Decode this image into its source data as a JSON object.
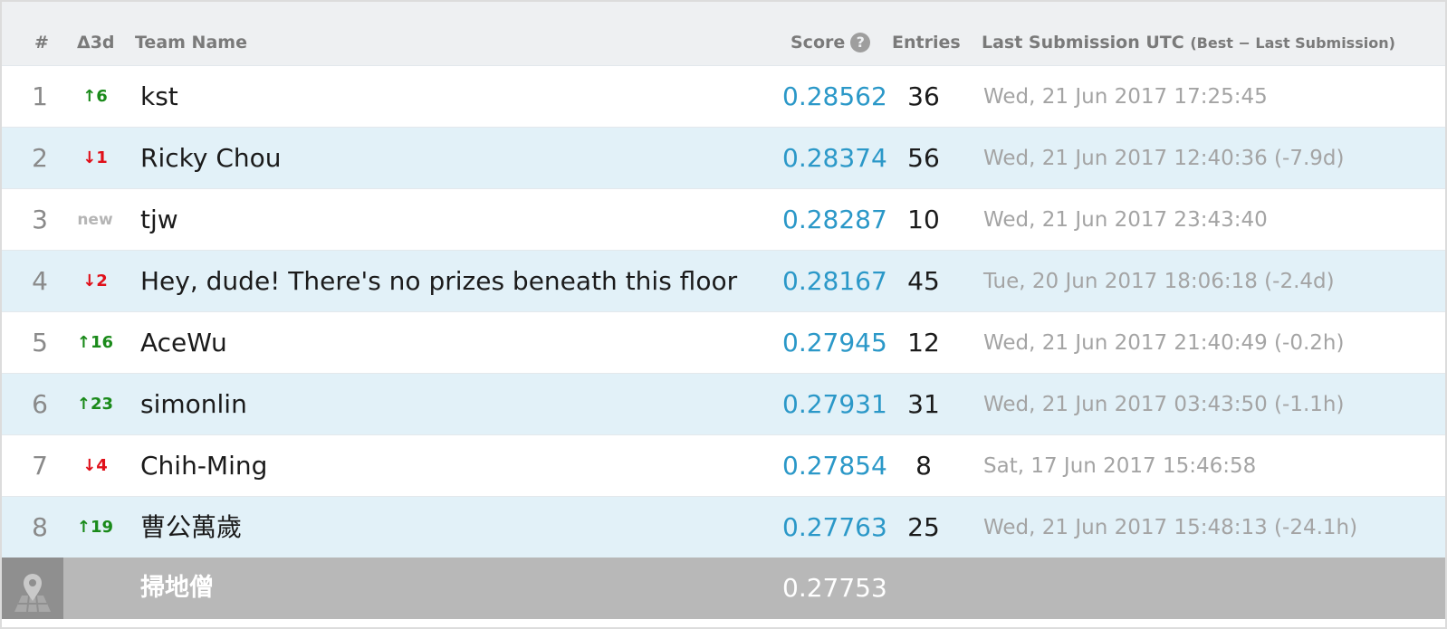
{
  "header": {
    "rank": "#",
    "delta": "Δ3d",
    "team": "Team Name",
    "score": "Score",
    "entries": "Entries",
    "last": "Last Submission UTC",
    "last_sub": "(Best − Last Submission)",
    "help_glyph": "?"
  },
  "rows": [
    {
      "rank": "1",
      "delta": "↑6",
      "team": "kst",
      "score": "0.28562",
      "entries": "36",
      "last": "Wed, 21 Jun 2017 17:25:45"
    },
    {
      "rank": "2",
      "delta": "↓1",
      "team": "Ricky Chou",
      "score": "0.28374",
      "entries": "56",
      "last": "Wed, 21 Jun 2017 12:40:36 (-7.9d)"
    },
    {
      "rank": "3",
      "delta": "new",
      "team": "tjw",
      "score": "0.28287",
      "entries": "10",
      "last": "Wed, 21 Jun 2017 23:43:40"
    },
    {
      "rank": "4",
      "delta": "↓2",
      "team": "Hey, dude! There's no prizes beneath this floor",
      "score": "0.28167",
      "entries": "45",
      "last": "Tue, 20 Jun 2017 18:06:18 (-2.4d)"
    },
    {
      "rank": "5",
      "delta": "↑16",
      "team": "AceWu",
      "score": "0.27945",
      "entries": "12",
      "last": "Wed, 21 Jun 2017 21:40:49 (-0.2h)"
    },
    {
      "rank": "6",
      "delta": "↑23",
      "team": "simonlin",
      "score": "0.27931",
      "entries": "31",
      "last": "Wed, 21 Jun 2017 03:43:50 (-1.1h)"
    },
    {
      "rank": "7",
      "delta": "↓4",
      "team": "Chih-Ming",
      "score": "0.27854",
      "entries": "8",
      "last": "Sat, 17 Jun 2017 15:46:58"
    },
    {
      "rank": "8",
      "delta": "↑19",
      "team": "曹公萬歲",
      "score": "0.27763",
      "entries": "25",
      "last": "Wed, 21 Jun 2017 15:48:13 (-24.1h)"
    }
  ],
  "threshold": {
    "icon": "map-pin-icon",
    "team": "掃地僧",
    "score": "0.27753"
  },
  "colors": {
    "score_blue": "#2b98c8",
    "delta_up": "#1a8a1a",
    "delta_down": "#e0101a",
    "row_alt": "#e2f1f8",
    "threshold_bg": "#b8b8b8"
  }
}
